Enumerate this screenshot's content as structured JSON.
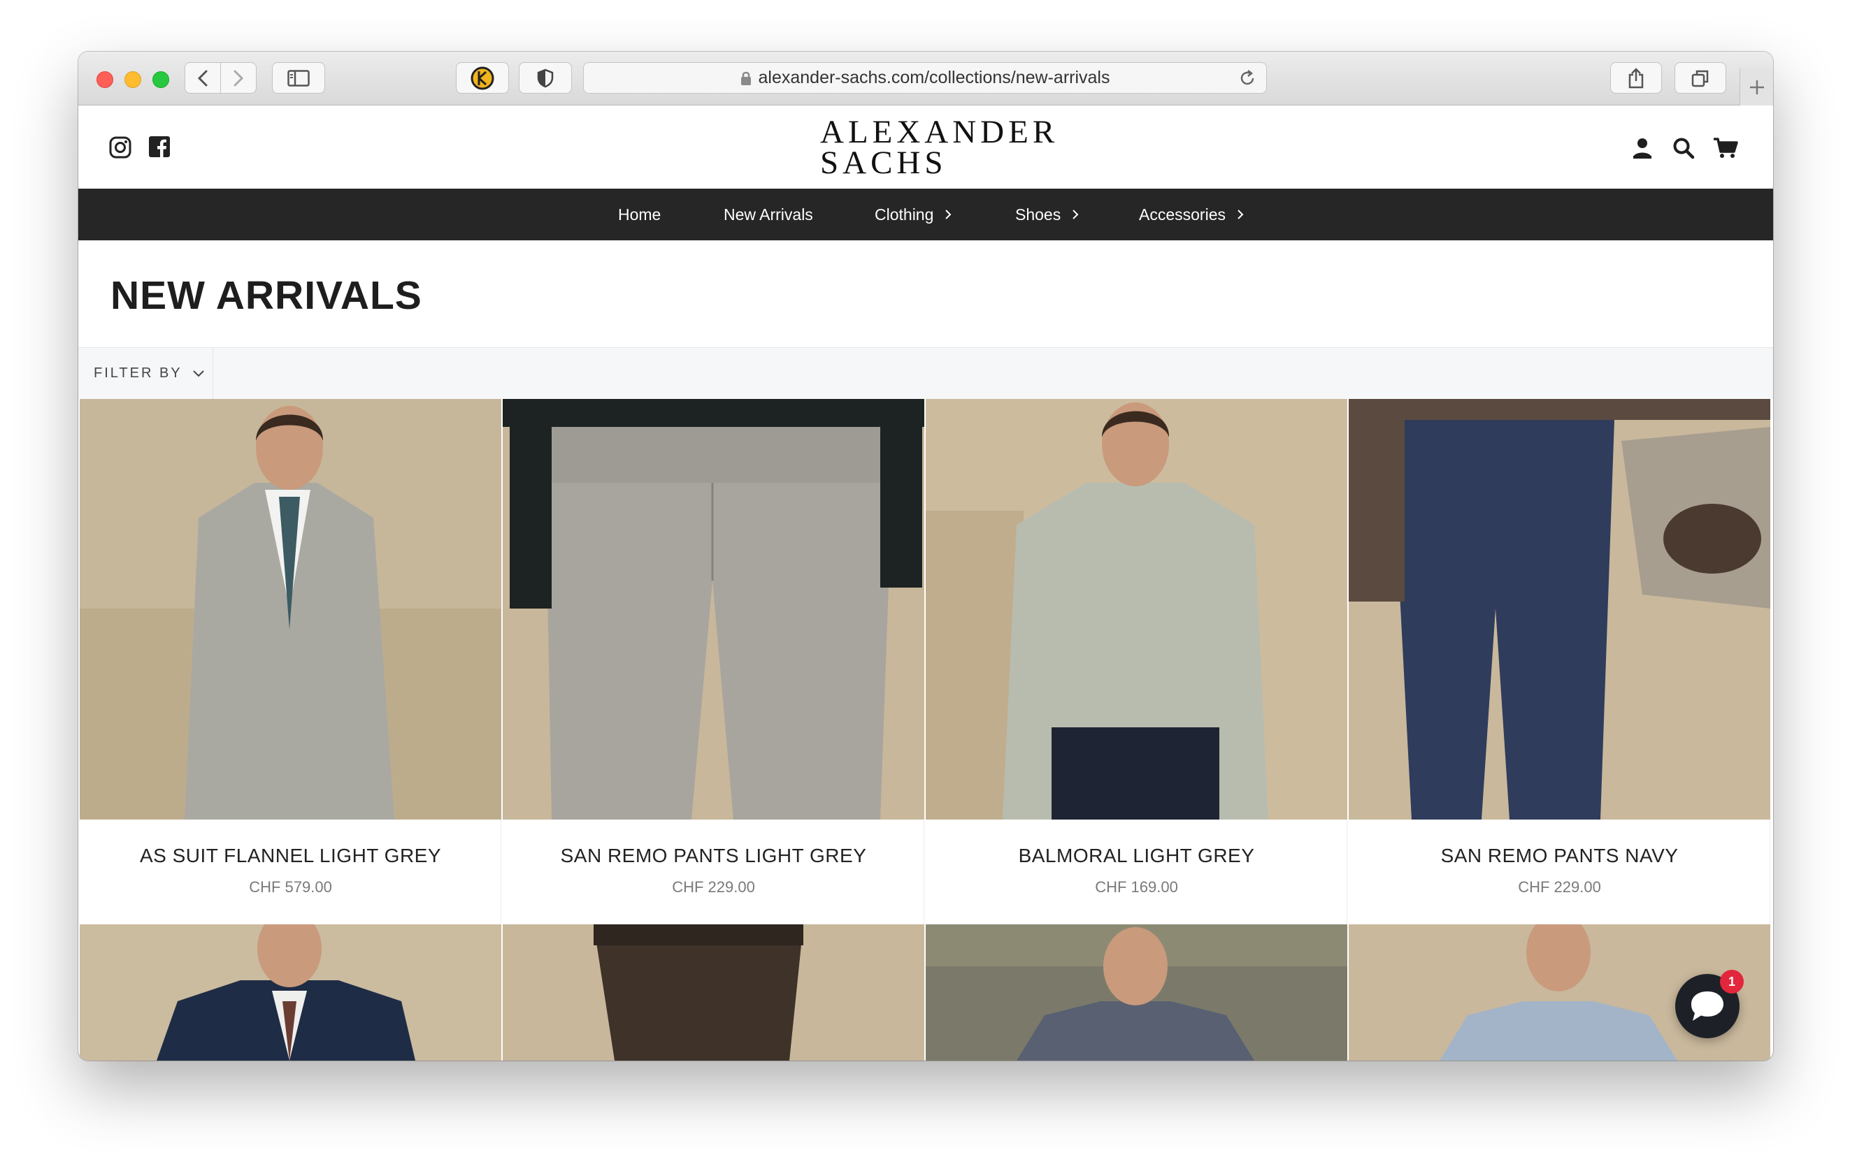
{
  "browser": {
    "url": "alexander-sachs.com/collections/new-arrivals"
  },
  "brand": {
    "logo_line1": "ALEXANDER",
    "logo_line2": "SACHS"
  },
  "nav": {
    "items": [
      {
        "label": "Home"
      },
      {
        "label": "New Arrivals"
      },
      {
        "label": "Clothing"
      },
      {
        "label": "Shoes"
      },
      {
        "label": "Accessories"
      }
    ]
  },
  "page": {
    "title": "NEW ARRIVALS"
  },
  "filter": {
    "label": "FILTER BY"
  },
  "products": [
    {
      "name": "AS SUIT FLANNEL LIGHT GREY",
      "price": "CHF 579.00"
    },
    {
      "name": "SAN REMO PANTS LIGHT GREY",
      "price": "CHF 229.00"
    },
    {
      "name": "BALMORAL LIGHT GREY",
      "price": "CHF 169.00"
    },
    {
      "name": "SAN REMO PANTS NAVY",
      "price": "CHF 229.00"
    }
  ],
  "chat": {
    "badge_count": "1"
  },
  "colors": {
    "navbar_bg": "#262626",
    "filter_bg": "#f6f7f9",
    "chat_bg": "#1d2127",
    "badge": "#e2263b"
  }
}
